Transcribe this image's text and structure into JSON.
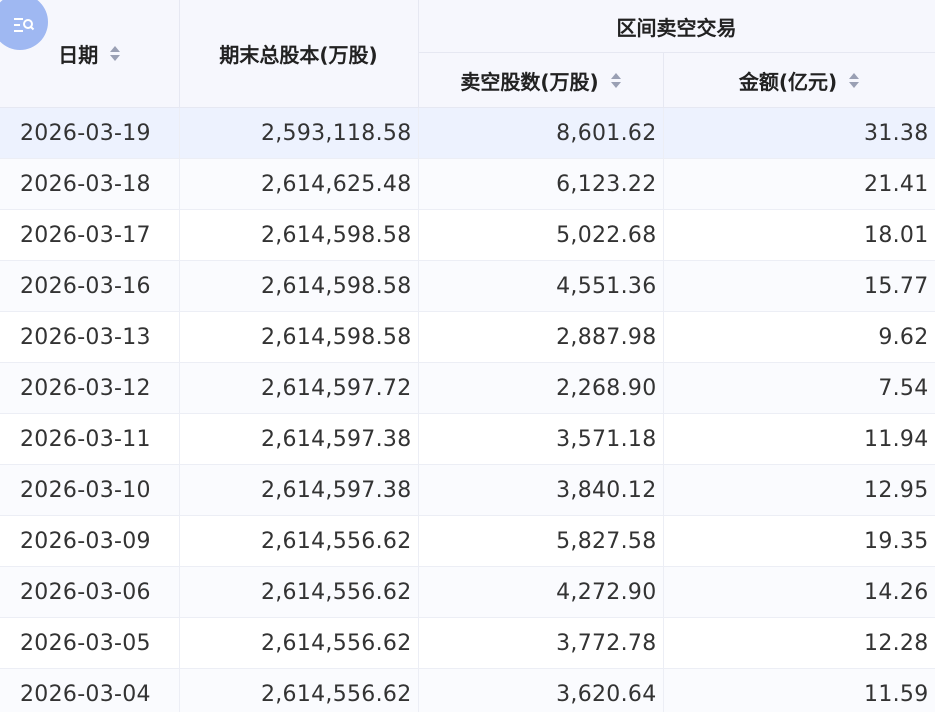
{
  "header": {
    "date_label": "日期",
    "total_shares_label": "期末总股本(万股)",
    "group_label": "区间卖空交易",
    "short_shares_label": "卖空股数(万股)",
    "amount_label": "金额(亿元)"
  },
  "icons": {
    "filter": "filter-search-icon",
    "sort": "sort-icon"
  },
  "colors": {
    "header_bg": "#f6f7fd",
    "highlight_row": "#edf2fe",
    "badge": "#9fb8f2"
  },
  "rows": [
    {
      "date": "2026-03-19",
      "total_shares": "2,593,118.58",
      "short_shares": "8,601.62",
      "amount": "31.38"
    },
    {
      "date": "2026-03-18",
      "total_shares": "2,614,625.48",
      "short_shares": "6,123.22",
      "amount": "21.41"
    },
    {
      "date": "2026-03-17",
      "total_shares": "2,614,598.58",
      "short_shares": "5,022.68",
      "amount": "18.01"
    },
    {
      "date": "2026-03-16",
      "total_shares": "2,614,598.58",
      "short_shares": "4,551.36",
      "amount": "15.77"
    },
    {
      "date": "2026-03-13",
      "total_shares": "2,614,598.58",
      "short_shares": "2,887.98",
      "amount": "9.62"
    },
    {
      "date": "2026-03-12",
      "total_shares": "2,614,597.72",
      "short_shares": "2,268.90",
      "amount": "7.54"
    },
    {
      "date": "2026-03-11",
      "total_shares": "2,614,597.38",
      "short_shares": "3,571.18",
      "amount": "11.94"
    },
    {
      "date": "2026-03-10",
      "total_shares": "2,614,597.38",
      "short_shares": "3,840.12",
      "amount": "12.95"
    },
    {
      "date": "2026-03-09",
      "total_shares": "2,614,556.62",
      "short_shares": "5,827.58",
      "amount": "19.35"
    },
    {
      "date": "2026-03-06",
      "total_shares": "2,614,556.62",
      "short_shares": "4,272.90",
      "amount": "14.26"
    },
    {
      "date": "2026-03-05",
      "total_shares": "2,614,556.62",
      "short_shares": "3,772.78",
      "amount": "12.28"
    },
    {
      "date": "2026-03-04",
      "total_shares": "2,614,556.62",
      "short_shares": "3,620.64",
      "amount": "11.59"
    }
  ]
}
